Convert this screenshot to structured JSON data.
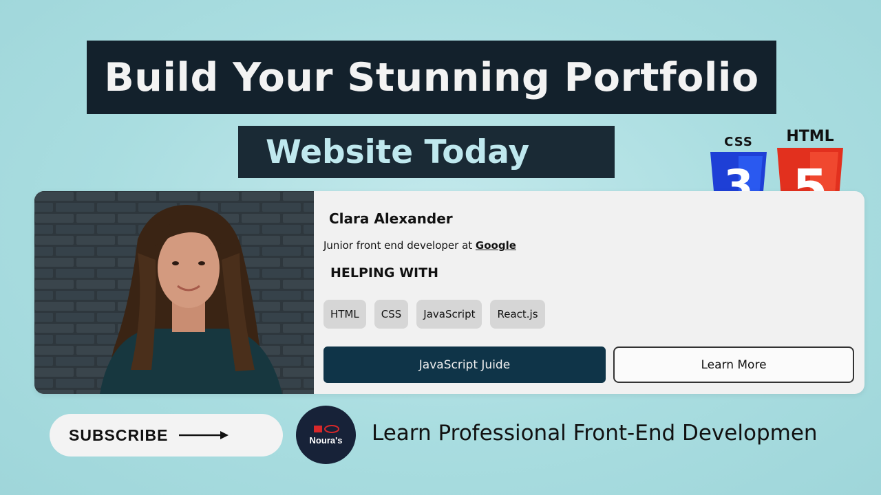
{
  "header": {
    "title_line1": "Build Your Stunning Portfolio",
    "title_line2": "Website Today"
  },
  "badges": {
    "css_label": "CSS",
    "css_number": "3",
    "html_label": "HTML",
    "html_number": "5"
  },
  "profile": {
    "name": "Clara Alexander",
    "role_prefix": "Junior front end developer at ",
    "company": "Google",
    "helping_heading": "HELPING WITH",
    "skills": [
      "HTML",
      "CSS",
      "JavaScript",
      "React.js"
    ],
    "primary_button": "JavaScript Juide",
    "secondary_button": "Learn More"
  },
  "footer": {
    "subscribe_label": "SUBSCRIBE",
    "logo_text": "Noura's",
    "tagline": "Learn Professional Front-End Developmen"
  },
  "colors": {
    "background": "#a9dde0",
    "title_bar": "#13212c",
    "title_line2_text": "#bfe8ee",
    "primary_button": "#0f3448",
    "css_blue": "#1e3fd6",
    "html_red": "#e2301e"
  }
}
